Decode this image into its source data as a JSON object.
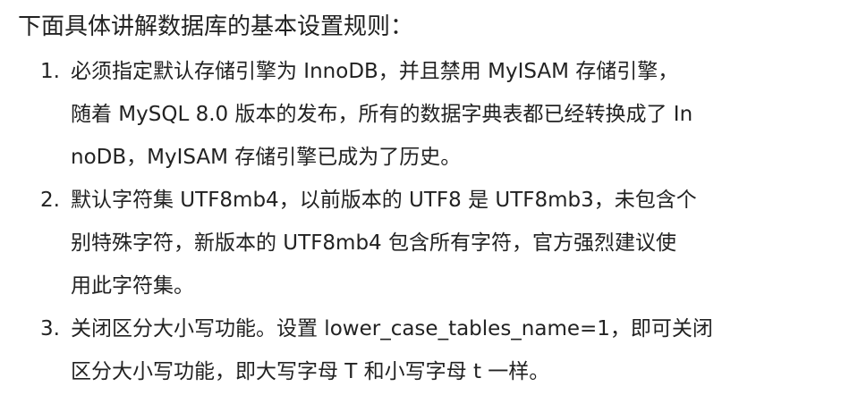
{
  "intro": "下面具体讲解数据库的基本设置规则：",
  "rules": [
    {
      "number": "1.",
      "lines": [
        "必须指定默认存储引擎为 InnoDB，并且禁用 MyISAM 存储引擎，",
        "随着 MySQL 8.0 版本的发布，所有的数据字典表都已经转换成了 In",
        "noDB，MyISAM 存储引擎已成为了历史。"
      ]
    },
    {
      "number": "2.",
      "lines": [
        "默认字符集 UTF8mb4，以前版本的 UTF8 是 UTF8mb3，未包含个",
        "别特殊字符，新版本的 UTF8mb4 包含所有字符，官方强烈建议使",
        "用此字符集。"
      ]
    },
    {
      "number": "3.",
      "lines": [
        "关闭区分大小写功能。设置 lower_case_tables_name=1，即可关闭",
        "区分大小写功能，即大写字母 T 和小写字母 t 一样。"
      ]
    }
  ]
}
